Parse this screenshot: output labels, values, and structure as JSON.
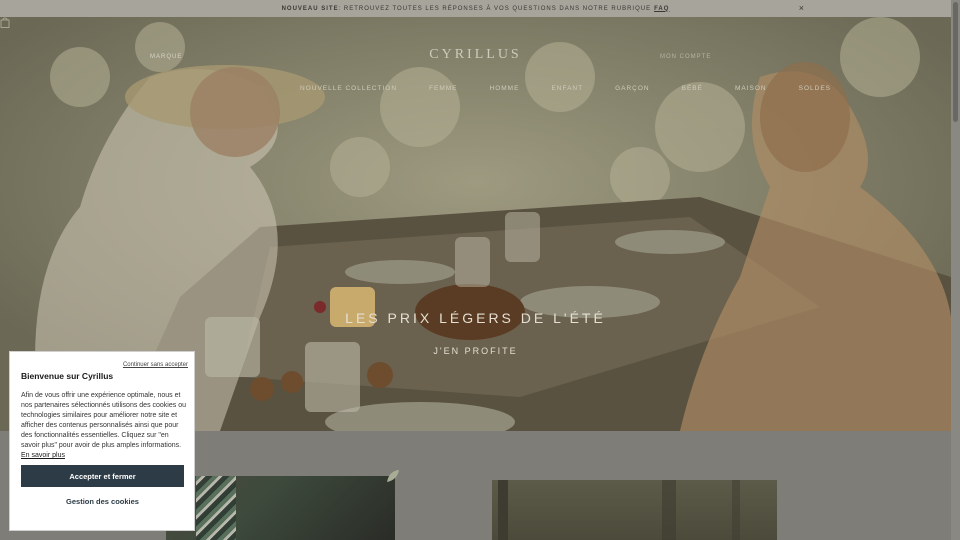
{
  "announcement": {
    "label": "NOUVEAU SITE",
    "text": " : RETROUVEZ TOUTES LES RÉPONSES À VOS QUESTIONS DANS NOTRE RUBRIQUE ",
    "link": "FAQ",
    "close": "×"
  },
  "header": {
    "left_link": "MARQUE",
    "logo": "CYRILLUS",
    "right_link": "MON COMPTE"
  },
  "nav": {
    "items": [
      "NOUVELLE COLLECTION",
      "FEMME",
      "HOMME",
      "ENFANT",
      "GARÇON",
      "BÉBÉ",
      "MAISON",
      "SOLDES"
    ]
  },
  "hero": {
    "title": "LES PRIX LÉGERS DE L'ÉTÉ",
    "cta": "J'EN PROFITE"
  },
  "cookie_banner": {
    "continue_link": "Continuer sans accepter",
    "title": "Bienvenue sur Cyrillus",
    "body": "Afin de vous offrir une expérience optimale, nous et nos partenaires sélectionnés utilisons des cookies ou technologies similaires pour améliorer notre site et afficher des contenus personnalisés ainsi que pour des fonctionnalités essentielles. Cliquez sur \"en savoir plus\" pour avoir de plus amples informations.",
    "learn_more": "En savoir plus",
    "accept_button": "Accepter et fermer",
    "manage_button": "Gestion des cookies"
  },
  "colors": {
    "accent": "#2c3b45",
    "announcement_bg": "#a7a49c",
    "overlay": "#7f7d78"
  }
}
